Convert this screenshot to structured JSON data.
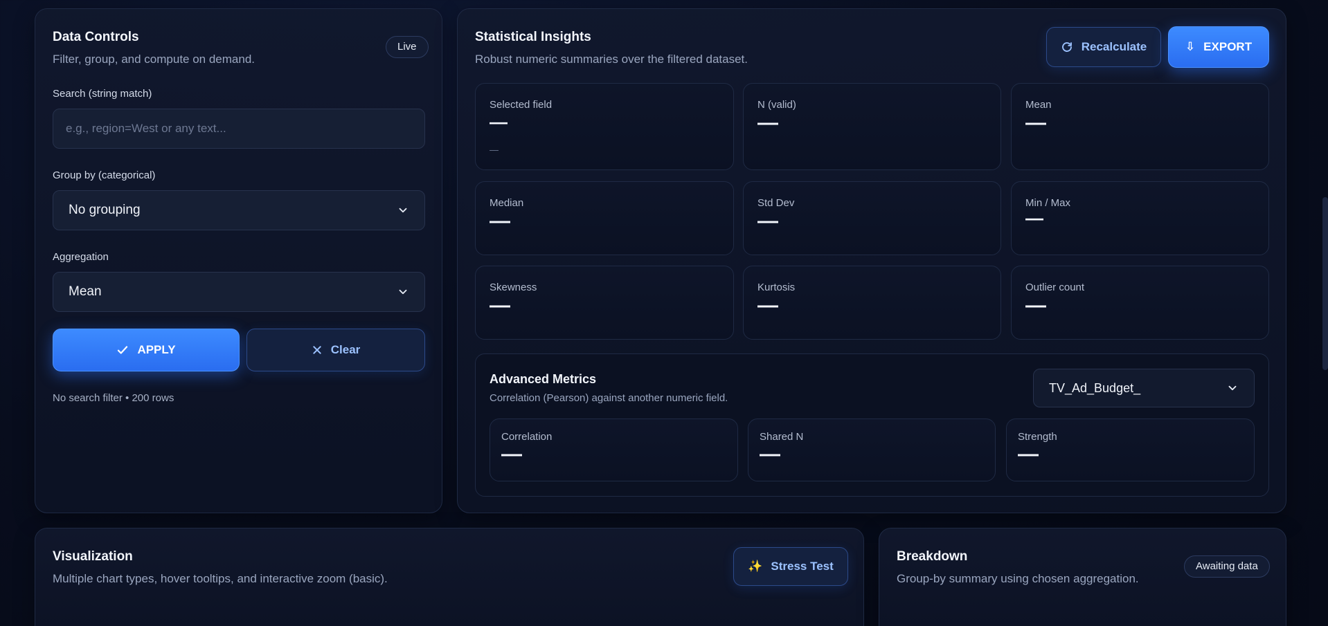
{
  "controls": {
    "title": "Data Controls",
    "subtitle": "Filter, group, and compute on demand.",
    "badge": "Live",
    "search_label": "Search (string match)",
    "search_placeholder": "e.g., region=West or any text...",
    "search_value": "",
    "group_label": "Group by (categorical)",
    "group_value": "No grouping",
    "agg_label": "Aggregation",
    "agg_value": "Mean",
    "apply_label": "APPLY",
    "clear_label": "Clear",
    "status": "No search filter • 200 rows"
  },
  "insights": {
    "title": "Statistical Insights",
    "subtitle": "Robust numeric summaries over the filtered dataset.",
    "recalc_label": "Recalculate",
    "export_label": "EXPORT",
    "stats": [
      {
        "label": "Selected field",
        "value": "—",
        "sub": "—"
      },
      {
        "label": "N (valid)",
        "value": "—"
      },
      {
        "label": "Mean",
        "value": "—"
      },
      {
        "label": "Median",
        "value": "—"
      },
      {
        "label": "Std Dev",
        "value": "—"
      },
      {
        "label": "Min / Max",
        "value": "—"
      },
      {
        "label": "Skewness",
        "value": "—"
      },
      {
        "label": "Kurtosis",
        "value": "—"
      },
      {
        "label": "Outlier count",
        "value": "—"
      }
    ],
    "advanced": {
      "title": "Advanced Metrics",
      "subtitle": "Correlation (Pearson) against another numeric field.",
      "field_value": "TV_Ad_Budget_",
      "metrics": [
        {
          "label": "Correlation",
          "value": "—"
        },
        {
          "label": "Shared N",
          "value": "—"
        },
        {
          "label": "Strength",
          "value": "—"
        }
      ]
    }
  },
  "visualization": {
    "title": "Visualization",
    "subtitle": "Multiple chart types, hover tooltips, and interactive zoom (basic).",
    "stress_label": "Stress Test"
  },
  "breakdown": {
    "title": "Breakdown",
    "subtitle": "Group-by summary using chosen aggregation.",
    "badge": "Awaiting data"
  },
  "colors": {
    "accent": "#3d8bff",
    "background": "#080d1d",
    "card": "#11182d"
  }
}
